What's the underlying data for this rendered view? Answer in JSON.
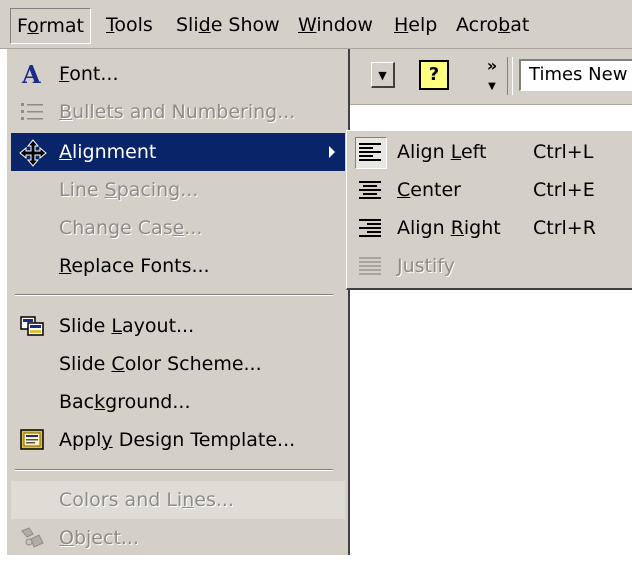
{
  "menubar": {
    "format": {
      "pre": "F",
      "u": "o",
      "post": "rmat"
    },
    "tools": {
      "pre": "",
      "u": "T",
      "post": "ools"
    },
    "slideshow": {
      "pre": "Sli",
      "u": "d",
      "post": "e Show"
    },
    "window": {
      "pre": "",
      "u": "W",
      "post": "indow"
    },
    "help": {
      "pre": "",
      "u": "H",
      "post": "elp"
    },
    "acrobat": {
      "pre": "Acro",
      "u": "b",
      "post": "at"
    }
  },
  "toolbar": {
    "dropdown_arrow": "▼",
    "help_glyph": "?",
    "more_glyph": "»",
    "font_box": "Times New"
  },
  "format_menu": {
    "font": {
      "pre": "",
      "u": "F",
      "post": "ont..."
    },
    "bullets": {
      "pre": "",
      "u": "B",
      "post": "ullets and Numbering..."
    },
    "alignment": {
      "pre": "",
      "u": "A",
      "post": "lignment"
    },
    "line_spacing": {
      "pre": "Line ",
      "u": "S",
      "post": "pacing..."
    },
    "change_case": {
      "pre": "Change Cas",
      "u": "e",
      "post": "..."
    },
    "replace_fonts": {
      "pre": "",
      "u": "R",
      "post": "eplace Fonts..."
    },
    "slide_layout": {
      "pre": "Slide ",
      "u": "L",
      "post": "ayout..."
    },
    "color_scheme": {
      "pre": "Slide ",
      "u": "C",
      "post": "olor Scheme..."
    },
    "background": {
      "pre": "Bac",
      "u": "k",
      "post": "ground..."
    },
    "design_template": {
      "pre": "Appl",
      "u": "y",
      "post": " Design Template..."
    },
    "colors_lines": {
      "pre": "Colors and Li",
      "u": "n",
      "post": "es..."
    },
    "object": {
      "pre": "",
      "u": "O",
      "post": "bject..."
    }
  },
  "align_submenu": {
    "left": {
      "pre": "Align ",
      "u": "L",
      "post": "eft",
      "shortcut": "Ctrl+L"
    },
    "center": {
      "pre": "",
      "u": "C",
      "post": "enter",
      "shortcut": "Ctrl+E"
    },
    "right": {
      "pre": "Align ",
      "u": "R",
      "post": "ight",
      "shortcut": "Ctrl+R"
    },
    "justify": {
      "pre": "",
      "u": "J",
      "post": "ustify"
    }
  },
  "icons": {
    "font": "font-A-icon",
    "bullets": "bullets-icon",
    "alignment": "move-cursor-icon",
    "slide_layout": "slide-layout-icon",
    "design_template": "design-template-icon",
    "object": "object-icon",
    "align_left": "align-left-icon",
    "align_center": "align-center-icon",
    "align_right": "align-right-icon",
    "justify": "justify-icon"
  },
  "colors": {
    "menu_bg": "#d4d0c8",
    "highlight_bg": "#0a246a",
    "disabled_text": "#8f8c86",
    "font_icon_blue": "#1a2b8c"
  }
}
